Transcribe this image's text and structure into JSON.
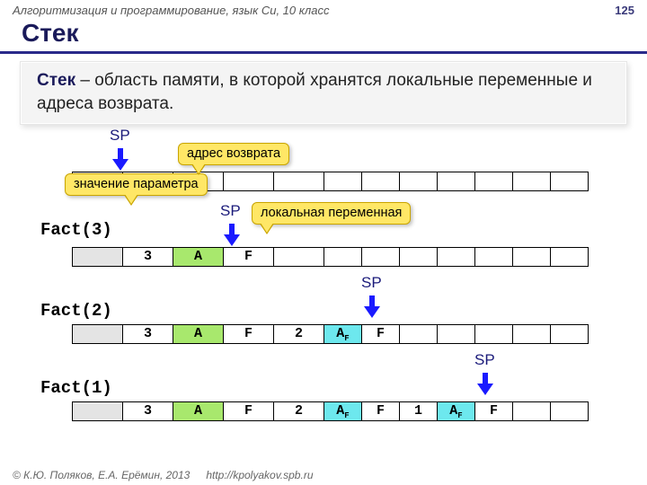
{
  "header": {
    "course": "Алгоритмизация и программирование, язык Си, 10 класс",
    "page": "125"
  },
  "title": "Стек",
  "definition": {
    "term": "Стек",
    "text": " – область памяти, в которой хранятся локальные переменные и адреса возврата."
  },
  "sp": "SP",
  "callouts": {
    "param": "значение параметра",
    "ret": "адрес возврата",
    "local": "локальная переменная"
  },
  "calls": {
    "c1": "Fact(3)",
    "c2": "Fact(2)",
    "c3": "Fact(1)"
  },
  "cells": {
    "v3": "3",
    "vA": "A",
    "vF": "F",
    "v2": "2",
    "vAF": "A",
    "subF": "F",
    "v1": "1"
  },
  "footer": {
    "copy": "© К.Ю. Поляков, Е.А. Ерёмин, 2013",
    "url": "http://kpolyakov.spb.ru"
  }
}
